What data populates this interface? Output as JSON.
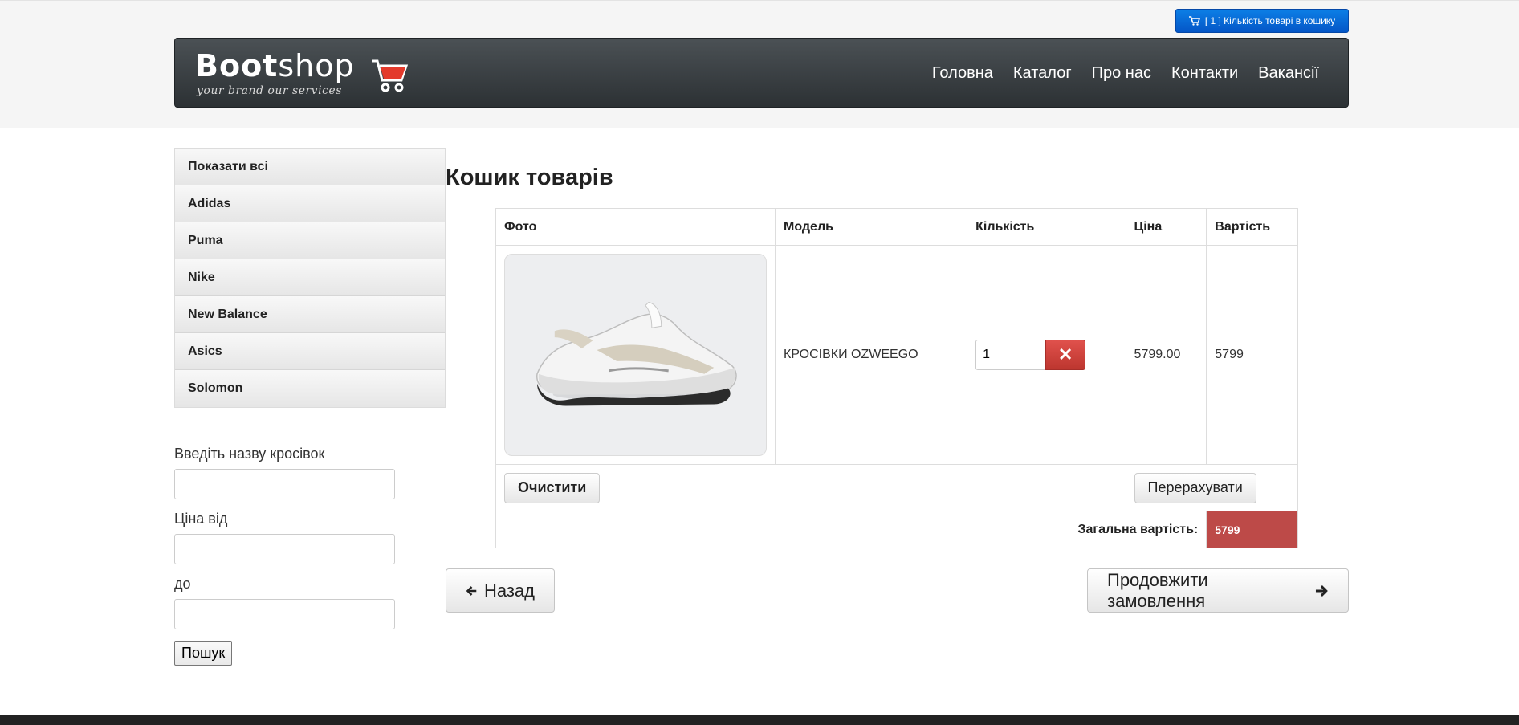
{
  "header": {
    "cart_button_label": "[ 1 ] Кількість товарі в кошику",
    "brand_bold": "Boot",
    "brand_light": "shop",
    "tagline": "your brand our services",
    "nav": [
      "Головна",
      "Каталог",
      "Про нас",
      "Контакти",
      "Вакансії"
    ]
  },
  "sidebar": {
    "items": [
      "Показати всі",
      "Adidas",
      "Puma",
      "Nike",
      "New Balance",
      "Asics",
      "Solomon"
    ]
  },
  "filter": {
    "name_label": "Введіть назву кросівок",
    "price_from_label": "Ціна від",
    "price_to_label": "до",
    "search_button": "Пошук"
  },
  "main": {
    "title": "Кошик товарів",
    "columns": [
      "Фото",
      "Модель",
      "Кількість",
      "Ціна",
      "Вартість"
    ],
    "items": [
      {
        "model": "КРОСІВКИ OZWEEGO",
        "quantity": "1",
        "price": "5799.00",
        "cost": "5799"
      }
    ],
    "clear_button": "Очистити",
    "recalc_button": "Перерахувати",
    "total_label": "Загальна вартість:",
    "total_value": "5799",
    "back_button": "Назад",
    "continue_button": "Продовжити замовлення"
  },
  "colors": {
    "cart_button": "#0c7fe6",
    "remove_button": "#bd362f",
    "total_badge": "#bd4a48",
    "navbar": "#3a3f42"
  }
}
